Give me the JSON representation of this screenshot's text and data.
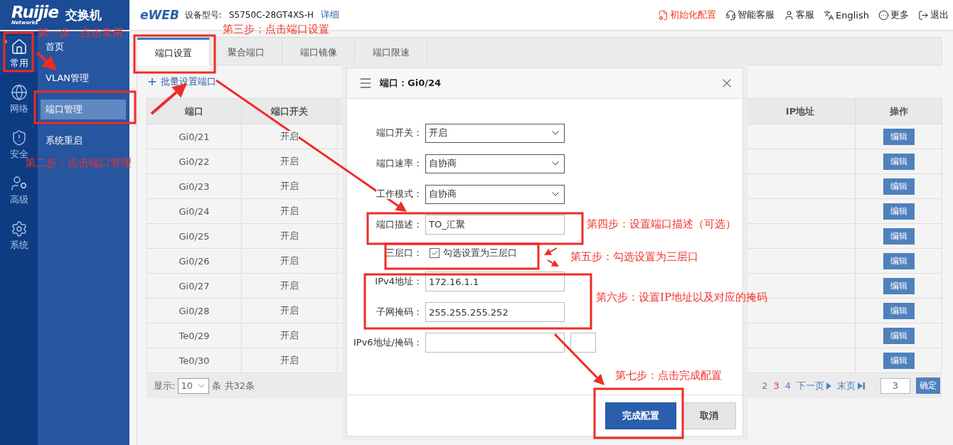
{
  "header": {
    "brand": {
      "logo": "Ruijie",
      "tagline": "Networks",
      "product": "交换机"
    },
    "eweb": "eWEB",
    "model_label": "设备型号:",
    "model": "S5750C-28GT4XS-H",
    "details_link": "详细",
    "links": [
      {
        "label": "初始化配置",
        "kind": "reset",
        "highlighted": true
      },
      {
        "label": "智能客服",
        "kind": "assistant",
        "highlighted": false
      },
      {
        "label": "客服",
        "kind": "support",
        "highlighted": false
      },
      {
        "label": "English",
        "kind": "language",
        "highlighted": false
      },
      {
        "label": "更多",
        "kind": "more",
        "highlighted": false
      },
      {
        "label": "退出",
        "kind": "logout",
        "highlighted": false
      }
    ]
  },
  "rail": [
    {
      "label": "常用",
      "kind": "home",
      "selected": true,
      "notified": true
    },
    {
      "label": "网络",
      "kind": "network",
      "selected": false,
      "notified": false
    },
    {
      "label": "安全",
      "kind": "security",
      "selected": false,
      "notified": false
    },
    {
      "label": "高级",
      "kind": "advanced",
      "selected": false,
      "notified": false
    },
    {
      "label": "系统",
      "kind": "system",
      "selected": false,
      "notified": false
    }
  ],
  "submenu": [
    {
      "label": "首页",
      "selected": false
    },
    {
      "label": "VLAN管理",
      "selected": false
    },
    {
      "label": "端口管理",
      "selected": true
    },
    {
      "label": "系统重启",
      "selected": false
    }
  ],
  "tabs": [
    {
      "label": "端口设置",
      "selected": true
    },
    {
      "label": "聚合端口",
      "selected": false
    },
    {
      "label": "端口镜像",
      "selected": false
    },
    {
      "label": "端口限速",
      "selected": false
    }
  ],
  "batch_link": "批量设置端口",
  "table": {
    "columns": [
      "端口",
      "端口开关",
      "IP地址",
      "操作"
    ],
    "rows": [
      {
        "port": "Gi0/21",
        "status": "开启",
        "action": "编辑"
      },
      {
        "port": "Gi0/22",
        "status": "开启",
        "action": "编辑"
      },
      {
        "port": "Gi0/23",
        "status": "开启",
        "action": "编辑"
      },
      {
        "port": "Gi0/24",
        "status": "开启",
        "action": "编辑"
      },
      {
        "port": "Gi0/25",
        "status": "开启",
        "action": "编辑"
      },
      {
        "port": "Gi0/26",
        "status": "开启",
        "action": "编辑"
      },
      {
        "port": "Gi0/27",
        "status": "开启",
        "action": "编辑"
      },
      {
        "port": "Gi0/28",
        "status": "开启",
        "action": "编辑"
      },
      {
        "port": "Te0/29",
        "status": "开启",
        "action": "编辑"
      },
      {
        "port": "Te0/30",
        "status": "开启",
        "action": "编辑"
      }
    ]
  },
  "pagination": {
    "show_label": "显示:",
    "page_size": "10",
    "total": "条 共32条",
    "pages": [
      {
        "label": "2",
        "selected": false
      },
      {
        "label": "3",
        "selected": true
      },
      {
        "label": "4",
        "selected": false
      }
    ],
    "next": "下一页",
    "last": "末页",
    "jump_value": "3",
    "confirm": "确定"
  },
  "dialog": {
    "title": "端口：Gi0/24",
    "fields": [
      {
        "kind": "select",
        "label": "端口开关：",
        "value": "开启"
      },
      {
        "kind": "select",
        "label": "端口速率：",
        "value": "自协商"
      },
      {
        "kind": "select",
        "label": "工作模式：",
        "value": "自协商"
      },
      {
        "kind": "text",
        "label": "端口描述：",
        "value": "TO_汇聚"
      },
      {
        "kind": "checkbox",
        "label": "三层口：",
        "option": "勾选设置为三层口",
        "checked": true
      },
      {
        "kind": "text",
        "label": "IPv4地址：",
        "value": "172.16.1.1"
      },
      {
        "kind": "text",
        "label": "子网掩码：",
        "value": "255.255.255.252"
      },
      {
        "kind": "ipv6",
        "label": "IPv6地址/掩码："
      }
    ],
    "buttons": [
      {
        "label": "完成配置",
        "kind": "primary"
      },
      {
        "label": "取消",
        "kind": "secondary"
      }
    ]
  },
  "annotations": [
    {
      "text": "第一步：点击常用"
    },
    {
      "text": "第二步：点击端口管理"
    },
    {
      "text": "第三步：点击端口设置"
    },
    {
      "text": "第四步：设置端口描述（可选）"
    },
    {
      "text": "第五步：勾选设置为三层口"
    },
    {
      "text": "第六步：设置IP地址以及对应的掩码"
    },
    {
      "text": "第七步：点击完成配置"
    }
  ]
}
